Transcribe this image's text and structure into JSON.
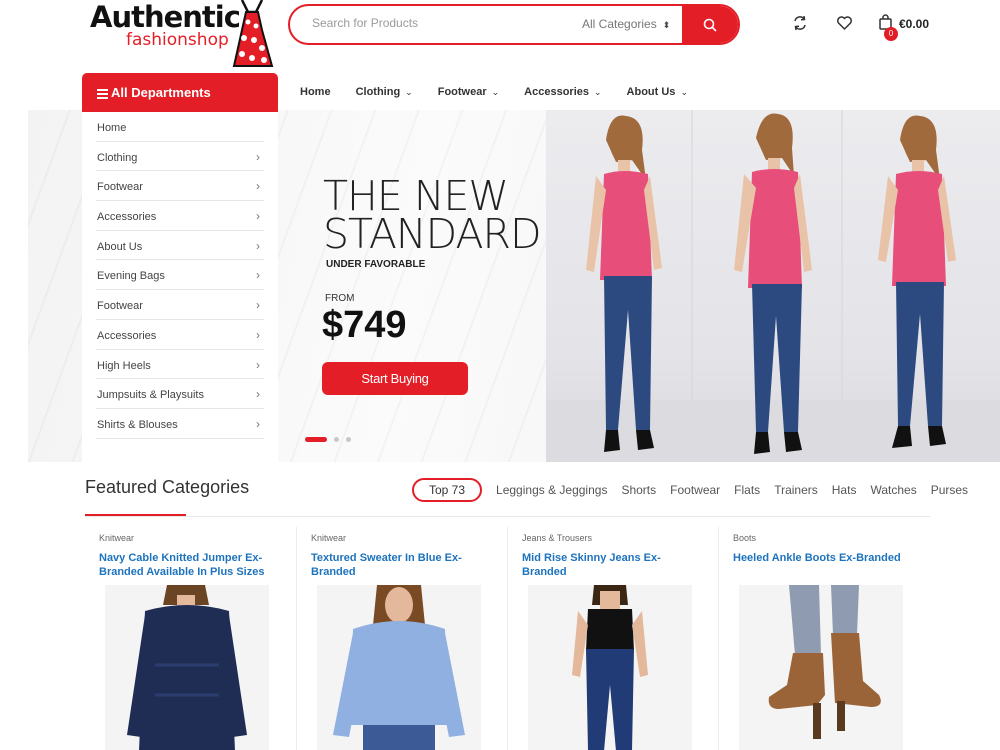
{
  "brand": {
    "name_main": "Authentic",
    "name_sub": "fashionshop"
  },
  "search": {
    "placeholder": "Search for Products",
    "category": "All Categories"
  },
  "cart": {
    "count": "0",
    "total": "€0.00"
  },
  "departments_label": "All Departments",
  "nav": [
    "Home",
    "Clothing",
    "Footwear",
    "Accessories",
    "About Us"
  ],
  "nav_dropdowns": [
    false,
    true,
    true,
    true,
    true
  ],
  "dept_menu": [
    "Home",
    "Clothing",
    "Footwear",
    "Accessories",
    "About Us",
    "Evening Bags",
    "Footwear",
    "Accessories",
    "High Heels",
    "Jumpsuits & Playsuits",
    "Shirts & Blouses"
  ],
  "dept_menu_has_submenu": [
    false,
    true,
    true,
    true,
    true,
    true,
    true,
    true,
    true,
    true,
    true
  ],
  "hero": {
    "title_line1": "THE NEW",
    "title_line2": "STANDARD",
    "subtitle": "UNDER FAVORABLE",
    "from_label": "FROM",
    "price": "$749",
    "cta": "Start Buying",
    "slide_count": 3,
    "active_slide": 1
  },
  "featured": {
    "title": "Featured Categories",
    "tabs": [
      "Top 73",
      "Leggings & Jeggings",
      "Shorts",
      "Footwear",
      "Flats",
      "Trainers",
      "Hats",
      "Watches",
      "Purses"
    ],
    "products": [
      {
        "category": "Knitwear",
        "name": "Navy Cable Knitted Jumper Ex-Branded Available In Plus Sizes",
        "image": "navy-jumper"
      },
      {
        "category": "Knitwear",
        "name": "Textured Sweater In Blue Ex-Branded",
        "image": "blue-sweater"
      },
      {
        "category": "Jeans & Trousers",
        "name": "Mid Rise Skinny Jeans Ex-Branded",
        "image": "skinny-jeans"
      },
      {
        "category": "Boots",
        "name": "Heeled Ankle Boots Ex-Branded",
        "image": "ankle-boots"
      }
    ]
  },
  "colors": {
    "accent": "#e41e26",
    "link": "#1e73be",
    "top": "#e84e7a",
    "jeans": "#2d4a80"
  }
}
